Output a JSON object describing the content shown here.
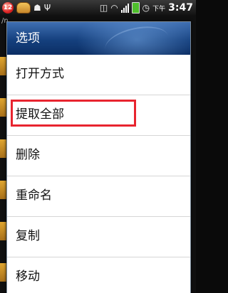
{
  "status_bar": {
    "notification_count": "12",
    "icons": [
      "burger-icon",
      "android-debug-icon",
      "usb-icon",
      "vibrate-icon",
      "wifi-icon",
      "signal-icon",
      "battery-icon",
      "alarm-icon"
    ],
    "ampm": "下午",
    "time": "3:47"
  },
  "background": {
    "path_fragment": "/n"
  },
  "dialog": {
    "title": "选项",
    "items": [
      {
        "label": "打开方式"
      },
      {
        "label": "提取全部"
      },
      {
        "label": "删除"
      },
      {
        "label": "重命名"
      },
      {
        "label": "复制"
      },
      {
        "label": "移动"
      }
    ],
    "highlighted_item": "提取全部",
    "highlight_color": "#e8242f",
    "header_color": "#15407e"
  }
}
